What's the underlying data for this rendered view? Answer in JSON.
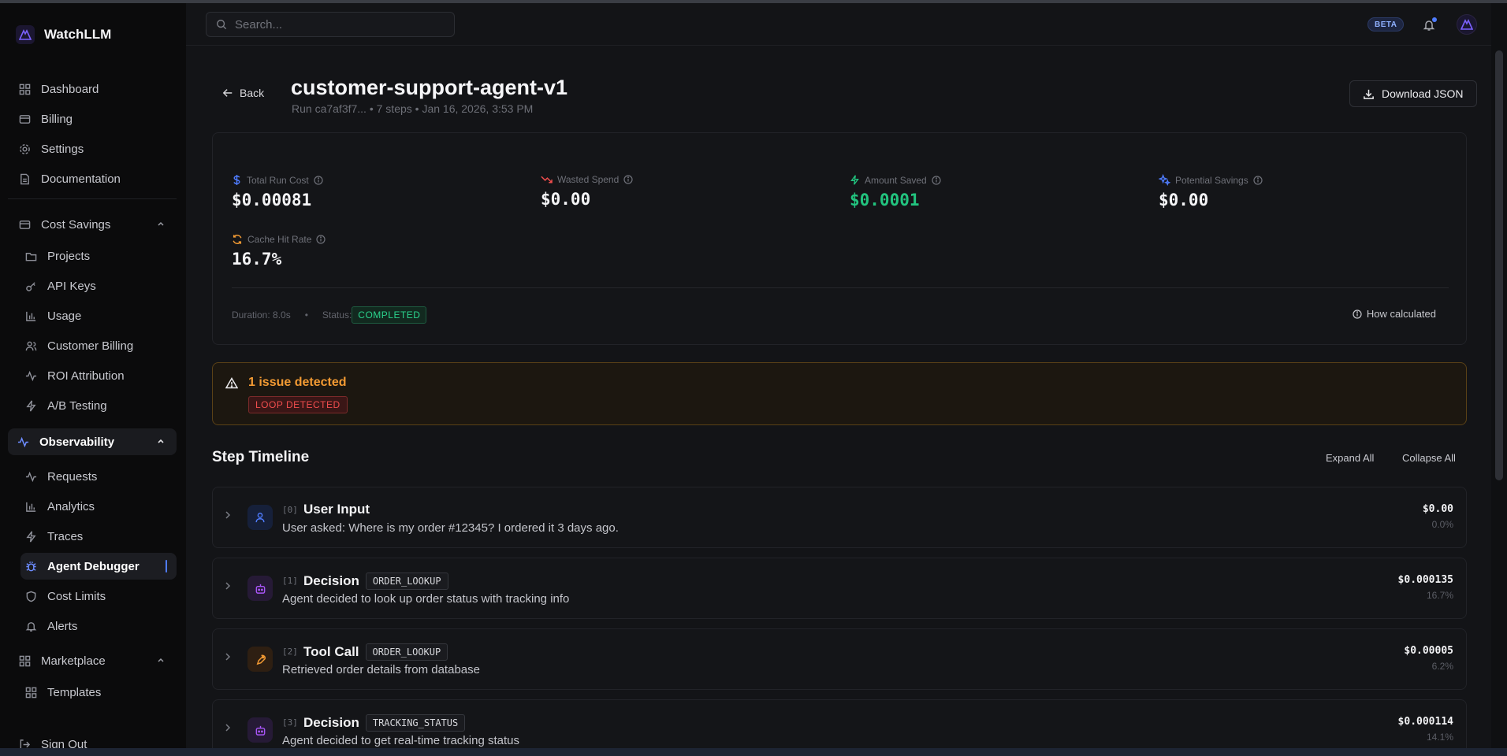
{
  "app": {
    "name": "WatchLLM"
  },
  "sidebar": {
    "main_items": [
      {
        "label": "Dashboard",
        "icon": "dashboard-icon"
      },
      {
        "label": "Billing",
        "icon": "credit-card-icon"
      },
      {
        "label": "Settings",
        "icon": "gear-icon"
      },
      {
        "label": "Documentation",
        "icon": "document-icon"
      }
    ],
    "cost_savings": {
      "label": "Cost Savings",
      "items": [
        {
          "label": "Projects",
          "icon": "folder-icon"
        },
        {
          "label": "API Keys",
          "icon": "key-icon"
        },
        {
          "label": "Usage",
          "icon": "bar-chart-icon"
        },
        {
          "label": "Customer Billing",
          "icon": "users-icon"
        },
        {
          "label": "ROI Attribution",
          "icon": "activity-icon"
        },
        {
          "label": "A/B Testing",
          "icon": "zap-icon"
        }
      ]
    },
    "observability": {
      "label": "Observability",
      "items": [
        {
          "label": "Requests",
          "icon": "activity-icon"
        },
        {
          "label": "Analytics",
          "icon": "bar-chart-icon"
        },
        {
          "label": "Traces",
          "icon": "zap-icon"
        },
        {
          "label": "Agent Debugger",
          "icon": "bug-icon",
          "active": true
        },
        {
          "label": "Cost Limits",
          "icon": "shield-icon"
        },
        {
          "label": "Alerts",
          "icon": "bell-icon"
        }
      ]
    },
    "marketplace": {
      "label": "Marketplace",
      "items": [
        {
          "label": "Templates",
          "icon": "grid-icon"
        }
      ]
    },
    "sign_out": "Sign Out"
  },
  "topbar": {
    "search_placeholder": "Search...",
    "beta_label": "BETA"
  },
  "header": {
    "back_label": "Back",
    "title": "customer-support-agent-v1",
    "subtitle": "Run ca7af3f7... • 7 steps • Jan 16, 2026, 3:53 PM",
    "download_label": "Download JSON"
  },
  "metrics": {
    "total_run_cost": {
      "label": "Total Run Cost",
      "value": "$0.00081",
      "color": "#4f7cff"
    },
    "wasted_spend": {
      "label": "Wasted Spend",
      "value": "$0.00",
      "color": "#f04d4d"
    },
    "amount_saved": {
      "label": "Amount Saved",
      "value": "$0.0001",
      "color": "#22c47f"
    },
    "potential_savings": {
      "label": "Potential Savings",
      "value": "$0.00",
      "color": "#4f7cff"
    },
    "cache_hit_rate": {
      "label": "Cache Hit Rate",
      "value": "16.7%",
      "color": "#f29a33"
    }
  },
  "run_footer": {
    "duration": "Duration: 8.0s",
    "separator": "•",
    "status_label": "Status:",
    "status_value": "COMPLETED",
    "how_calculated": "How calculated"
  },
  "issues": {
    "title": "1 issue detected",
    "badge": "LOOP DETECTED"
  },
  "timeline": {
    "title": "Step Timeline",
    "expand_all": "Expand All",
    "collapse_all": "Collapse All",
    "steps": [
      {
        "index": "[0]",
        "name": "User Input",
        "tag": "",
        "description": "User asked: Where is my order #12345? I ordered it 3 days ago.",
        "cost": "$0.00",
        "pct": "0.0%",
        "icon": "user-icon",
        "icon_color": "#4f7cff"
      },
      {
        "index": "[1]",
        "name": "Decision",
        "tag": "ORDER_LOOKUP",
        "description": "Agent decided to look up order status with tracking info",
        "cost": "$0.000135",
        "pct": "16.7%",
        "icon": "bot-icon",
        "icon_color": "#a855f7"
      },
      {
        "index": "[2]",
        "name": "Tool Call",
        "tag": "ORDER_LOOKUP",
        "description": "Retrieved order details from database",
        "cost": "$0.00005",
        "pct": "6.2%",
        "icon": "wrench-icon",
        "icon_color": "#f29a33"
      },
      {
        "index": "[3]",
        "name": "Decision",
        "tag": "TRACKING_STATUS",
        "description": "Agent decided to get real-time tracking status",
        "cost": "$0.000114",
        "pct": "14.1%",
        "icon": "bot-icon",
        "icon_color": "#a855f7"
      }
    ]
  }
}
